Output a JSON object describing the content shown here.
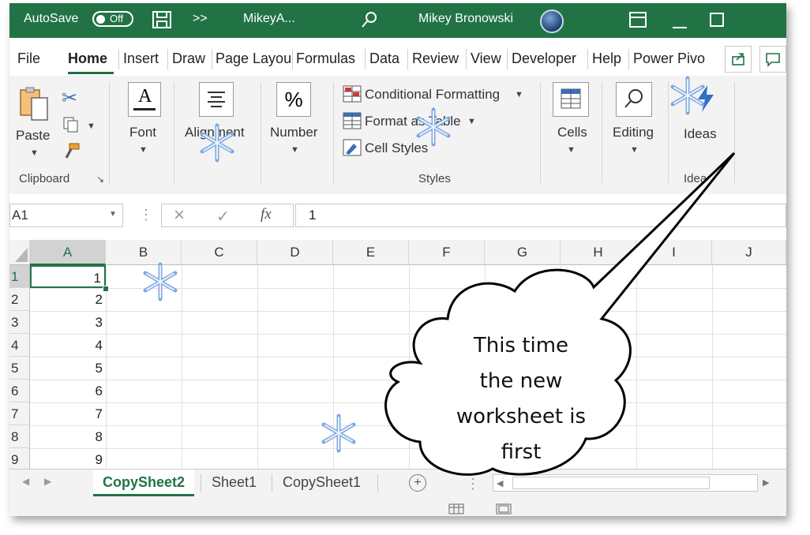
{
  "titlebar": {
    "autosave_label": "AutoSave",
    "autosave_state": "Off",
    "more_label": ">>",
    "doc_name": "MikeyA...",
    "user_name": "Mikey Bronowski"
  },
  "ribbon_tabs": [
    "File",
    "Home",
    "Insert",
    "Draw",
    "Page Layou",
    "Formulas",
    "Data",
    "Review",
    "View",
    "Developer",
    "Help",
    "Power Pivo"
  ],
  "ribbon": {
    "clipboard": {
      "paste_label": "Paste",
      "group_label": "Clipboard"
    },
    "font_label": "Font",
    "alignment_label": "Alignment",
    "number_label": "Number",
    "styles": {
      "conditional_formatting": "Conditional Formatting",
      "format_as_table": "Format as Table",
      "cell_styles": "Cell Styles",
      "group_label": "Styles"
    },
    "cells_label": "Cells",
    "editing_label": "Editing",
    "ideas": {
      "button_label": "Ideas",
      "group_label": "Ideas"
    }
  },
  "formula_bar": {
    "name_box": "A1",
    "cancel_icon": "×",
    "enter_icon": "✓",
    "fx_label": "fx",
    "content": "1"
  },
  "grid": {
    "columns": [
      "A",
      "B",
      "C",
      "D",
      "E",
      "F",
      "G",
      "H",
      "I",
      "J"
    ],
    "rows": [
      "1",
      "2",
      "3",
      "4",
      "5",
      "6",
      "7",
      "8",
      "9"
    ],
    "column_a_values": [
      "1",
      "2",
      "3",
      "4",
      "5",
      "6",
      "7",
      "8",
      "9"
    ]
  },
  "sheet_tabs": [
    "CopySheet2",
    "Sheet1",
    "CopySheet1"
  ],
  "active_sheet": "CopySheet2",
  "callout_text": [
    "This time",
    "the new",
    "worksheet is",
    "first"
  ],
  "colors": {
    "accent": "#217346",
    "ribbon_bg": "#f3f3f3"
  }
}
